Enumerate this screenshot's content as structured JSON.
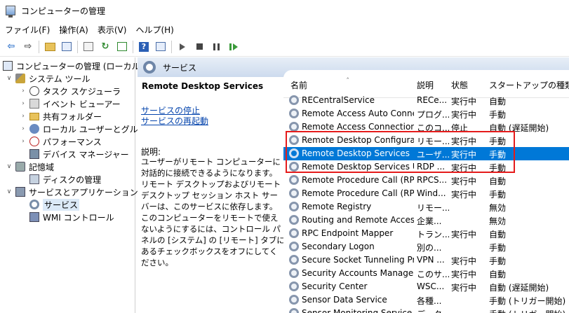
{
  "window": {
    "title": "コンピューターの管理"
  },
  "menu": [
    "ファイル(F)",
    "操作(A)",
    "表示(V)",
    "ヘルプ(H)"
  ],
  "tree": {
    "root": "コンピューターの管理 (ローカル)",
    "system_tools": "システム ツール",
    "task_scheduler": "タスク スケジューラ",
    "event_viewer": "イベント ビューアー",
    "shared_folders": "共有フォルダー",
    "local_users": "ローカル ユーザーとグループ",
    "performance": "パフォーマンス",
    "device_manager": "デバイス マネージャー",
    "storage": "記憶域",
    "disk_management": "ディスクの管理",
    "services_apps": "サービスとアプリケーション",
    "services": "サービス",
    "wmi": "WMI コントロール"
  },
  "services_header": "サービス",
  "detail": {
    "name": "Remote Desktop Services",
    "stop_link": "サービスの停止",
    "restart_link": "サービスの再起動",
    "desc_label": "説明:",
    "desc_text": "ユーザーがリモート コンピューターに対話的に接続できるようになります。リモート デスクトップおよびリモート デスクトップ セッション ホスト サーバーは、このサービスに依存します。このコンピューターをリモートで使えないようにするには、コントロール パネルの [システム] の [リモート] タブにあるチェックボックスをオフにしてください。"
  },
  "columns": {
    "name": "名前",
    "desc": "説明",
    "status": "状態",
    "startup": "スタートアップの種類"
  },
  "rows": [
    {
      "name": "RECentralService",
      "desc": "RECe...",
      "status": "実行中",
      "startup": "自動"
    },
    {
      "name": "Remote Access Auto Conne...",
      "desc": "プログ...",
      "status": "実行中",
      "startup": "手動"
    },
    {
      "name": "Remote Access Connection ...",
      "desc": "このコ...",
      "status": "停止",
      "startup": "自動 (遅延開始)"
    },
    {
      "name": "Remote Desktop Configurat",
      "desc": "リモー...",
      "status": "実行中",
      "startup": "手動"
    },
    {
      "name": "Remote Desktop Services",
      "desc": "ユーザ...",
      "status": "実行中",
      "startup": "手動"
    },
    {
      "name": "Remote Desktop Services Us...",
      "desc": "RDP ...",
      "status": "実行中",
      "startup": "手動"
    },
    {
      "name": "Remote Procedure Call (RPC)",
      "desc": "RPCS...",
      "status": "実行中",
      "startup": "自動"
    },
    {
      "name": "Remote Procedure Call (RPC)",
      "desc": "Wind...",
      "status": "実行中",
      "startup": "手動"
    },
    {
      "name": "Remote Registry",
      "desc": "リモー...",
      "status": "",
      "startup": "無効"
    },
    {
      "name": "Routing and Remote Access",
      "desc": "企業...",
      "status": "",
      "startup": "無効"
    },
    {
      "name": "RPC Endpoint Mapper",
      "desc": "トラン...",
      "status": "実行中",
      "startup": "自動"
    },
    {
      "name": "Secondary Logon",
      "desc": "別の...",
      "status": "",
      "startup": "手動"
    },
    {
      "name": "Secure Socket Tunneling Pr...",
      "desc": "VPN ...",
      "status": "実行中",
      "startup": "手動"
    },
    {
      "name": "Security Accounts Manager",
      "desc": "このサ...",
      "status": "実行中",
      "startup": "自動"
    },
    {
      "name": "Security Center",
      "desc": "WSC...",
      "status": "実行中",
      "startup": "自動 (遅延開始)"
    },
    {
      "name": "Sensor Data Service",
      "desc": "各種...",
      "status": "",
      "startup": "手動 (トリガー開始)"
    },
    {
      "name": "Sensor Monitoring Service",
      "desc": "データ...",
      "status": "",
      "startup": "手動 (トリガー開始)"
    }
  ],
  "selected_row": 4
}
